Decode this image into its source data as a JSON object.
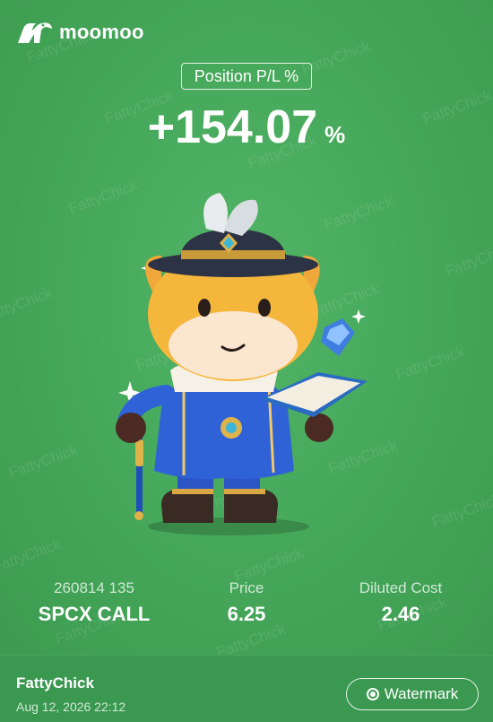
{
  "brand": {
    "name": "moomoo",
    "logo_icon": "bull-icon"
  },
  "header": {
    "pl_label": "Position P/L %",
    "pl_value": "+154.07",
    "pl_unit": "%"
  },
  "watermark_text": "FattyChick",
  "stats": [
    {
      "label": "260814 135",
      "value": "SPCX CALL"
    },
    {
      "label": "Price",
      "value": "6.25"
    },
    {
      "label": "Diluted Cost",
      "value": "2.46"
    }
  ],
  "footer": {
    "username": "FattyChick",
    "timestamp": "Aug 12, 2026 22:12",
    "watermark_button": "Watermark",
    "watermark_icon": "radio-selected-icon"
  },
  "colors": {
    "background": "#47a95b",
    "text": "#ffffff"
  }
}
